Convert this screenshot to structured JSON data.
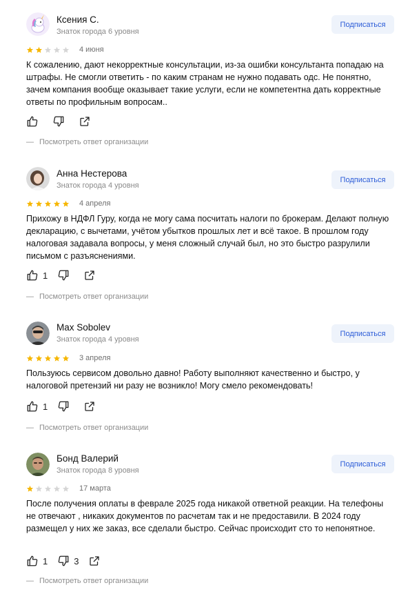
{
  "subscribe_label": "Подписаться",
  "org_reply_dash": "—",
  "org_reply_label": "Посмотреть ответ организации",
  "colors": {
    "star_filled": "#f6b600",
    "star_empty": "#d6d6d6",
    "subscribe_text": "#2a5bd7",
    "subscribe_bg": "#eef3fb"
  },
  "reviews": [
    {
      "name": "Ксения С.",
      "badge": "Знаток города 6 уровня",
      "rating": 2,
      "date": "4 июня",
      "text": "К сожалению, дают некорректные консультации, из-за ошибки консультанта попадаю на штрафы. Не смогли ответить - по каким странам не нужно подавать одс. Не понятно, зачем компания вообще оказывает такие услуги, если не компетентна дать корректные ответы по профильным вопросам..",
      "likes": "",
      "dislikes": "",
      "avatar_icon": "unicorn-avatar"
    },
    {
      "name": "Анна Нестерова",
      "badge": "Знаток города 4 уровня",
      "rating": 5,
      "date": "4 апреля",
      "text": "Прихожу в НДФЛ Гуру, когда не могу сама посчитать налоги по брокерам. Делают полную декларацию, с вычетами, учётом убытков прошлых лет и всё такое. В прошлом году налоговая задавала вопросы, у меня сложный случай был, но это быстро разрулили письмом с разъяснениями.",
      "likes": "1",
      "dislikes": "",
      "avatar_icon": "woman-photo-avatar"
    },
    {
      "name": "Max Sobolev",
      "badge": "Знаток города 4 уровня",
      "rating": 5,
      "date": "3 апреля",
      "text": "Пользуюсь сервисом довольно давно! Работу выполняют качественно и быстро, у налоговой претензий ни разу не возникло! Могу смело рекомендовать!",
      "likes": "1",
      "dislikes": "",
      "avatar_icon": "man-sunglasses-avatar"
    },
    {
      "name": "Бонд Валерий",
      "badge": "Знаток города 8 уровня",
      "rating": 1,
      "date": "17 марта",
      "text": "После получения оплаты в феврале 2025 года никакой ответной реакции. На телефоны не отвечают , никаких документов по расчетам так и не предоставили. В 2024 году размещел у них же заказ, все сделали быстро. Сейчас происходит сто то непонятное.",
      "likes": "1",
      "dislikes": "3",
      "avatar_icon": "man-outdoor-avatar"
    }
  ]
}
